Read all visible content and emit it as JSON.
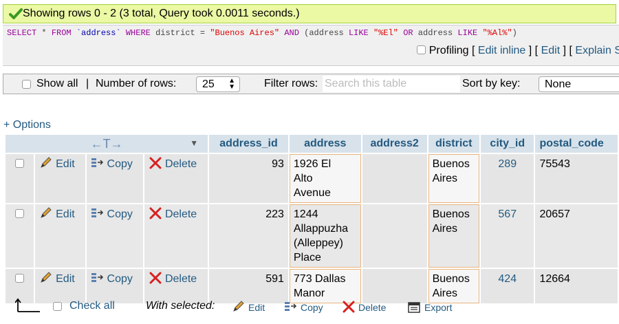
{
  "message": "Showing rows 0 - 2 (3 total, Query took 0.0011 seconds.)",
  "sql": {
    "select": "SELECT",
    "star_from": " * ",
    "from": "FROM",
    "table": "`address`",
    "where": "WHERE",
    "col1": "district",
    "eq": "=",
    "val1": "\"Buenos Aires\"",
    "and": "AND",
    "paren_open": "(address",
    "like1": "LIKE",
    "val2": "\"%El\"",
    "or": "OR",
    "col3": "address",
    "like2": "LIKE",
    "val3": "\"%Al%\"",
    "paren_close": ")"
  },
  "sql_links": {
    "profiling": "Profiling",
    "edit_inline": "Edit inline",
    "edit": "Edit",
    "explain": "Explain S",
    "br_open": "[",
    "br_close": "]"
  },
  "nav": {
    "show_all": "Show all",
    "sep": "|",
    "rows_label": "Number of rows:",
    "rows_value": "25",
    "filter_label": "Filter rows:",
    "filter_placeholder": "Search this table",
    "sort_label": "Sort by key:",
    "sort_value": "None"
  },
  "options_link": "+ Options",
  "columns": [
    "address_id",
    "address",
    "address2",
    "district",
    "city_id",
    "postal_code"
  ],
  "actions": {
    "edit": "Edit",
    "copy": "Copy",
    "delete": "Delete"
  },
  "rows": [
    {
      "address_id": "93",
      "address": [
        "1926 El",
        "Alto",
        "Avenue"
      ],
      "address2": "",
      "district": [
        "Buenos",
        "Aires"
      ],
      "city_id": "289",
      "postal_code": "75543"
    },
    {
      "address_id": "223",
      "address": [
        "1244",
        "Allappuzha",
        "(Alleppey)",
        "Place"
      ],
      "address2": "",
      "district": [
        "Buenos",
        "Aires"
      ],
      "city_id": "567",
      "postal_code": "20657"
    },
    {
      "address_id": "591",
      "address": [
        "773 Dallas",
        "Manor"
      ],
      "address2": "",
      "district": [
        "Buenos",
        "Aires"
      ],
      "city_id": "424",
      "postal_code": "12664"
    }
  ],
  "bottom": {
    "check_all": "Check all",
    "with_selected": "With selected:",
    "edit": "Edit",
    "copy": "Copy",
    "delete": "Delete",
    "export": "Export"
  }
}
